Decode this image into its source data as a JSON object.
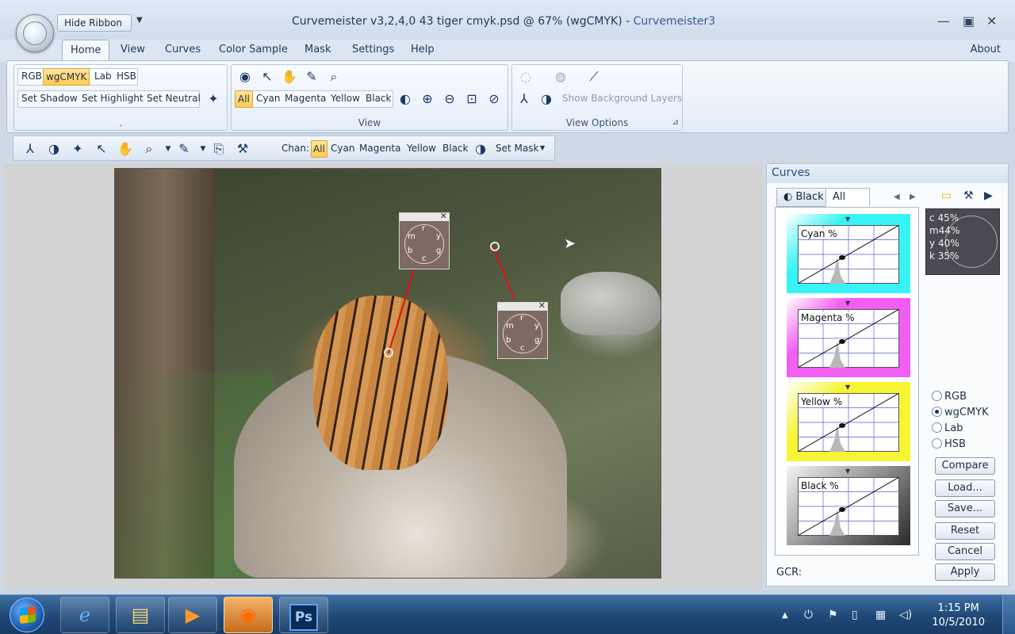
{
  "titlebar": {
    "hide_ribbon": "Hide Ribbon",
    "title_main": "Curvemeister v3,2,4,0       43 tiger cmyk.psd @ 67% (wgCMYK) - ",
    "title_app": "Curvemeister3",
    "minimize": "—",
    "maximize": "▣",
    "close": "✕"
  },
  "ribbon_tabs": [
    "Home",
    "View",
    "Curves",
    "Color Sample",
    "Mask",
    "Settings",
    "Help"
  ],
  "about": "About",
  "groups": {
    "mode": {
      "modes": [
        "RGB",
        "wgCMYK",
        "Lab",
        "HSB"
      ],
      "actions": [
        "Set Shadow",
        "Set Highlight",
        "Set Neutral"
      ],
      "label": "."
    },
    "view": {
      "channels": [
        "All",
        "Cyan",
        "Magenta",
        "Yellow",
        "Black"
      ],
      "label": "View"
    },
    "view_options": {
      "show_bg": "Show Background Layers",
      "label": "View Options"
    }
  },
  "toolbar2": {
    "chan_label": "Chan:",
    "channels": [
      "All",
      "Cyan",
      "Magenta",
      "Yellow",
      "Black"
    ],
    "set_mask": "Set Mask"
  },
  "samplers": [
    {
      "letters": {
        "top": "r",
        "left": "m",
        "right": "y",
        "bl": "b",
        "br": "g",
        "bottom": "c"
      }
    },
    {
      "letters": {
        "top": "r",
        "left": "m",
        "right": "y",
        "bl": "b",
        "br": "g",
        "bottom": "c"
      }
    }
  ],
  "curves": {
    "title": "Curves",
    "tabs": [
      "Black",
      "All"
    ],
    "panels": [
      {
        "label": "Cyan %",
        "color": "#37f3f5"
      },
      {
        "label": "Magenta %",
        "color": "#f25df2"
      },
      {
        "label": "Yellow %",
        "color": "#f5f536"
      },
      {
        "label": "Black %",
        "color": "#4a4a4a"
      }
    ],
    "readout": [
      {
        "ch": "c",
        "val": "45%"
      },
      {
        "ch": "m",
        "val": "44%"
      },
      {
        "ch": "y",
        "val": "40%"
      },
      {
        "ch": "k",
        "val": "35%"
      }
    ],
    "modes": [
      {
        "label": "RGB",
        "checked": false
      },
      {
        "label": "wgCMYK",
        "checked": true
      },
      {
        "label": "Lab",
        "checked": false
      },
      {
        "label": "HSB",
        "checked": false
      }
    ],
    "buttons": [
      "Compare",
      "Load...",
      "Save...",
      "Reset",
      "Cancel",
      "Apply"
    ],
    "gcr_label": "GCR:"
  },
  "taskbar": {
    "ps_label": "Ps",
    "time": "1:15 PM",
    "date": "10/5/2010"
  }
}
